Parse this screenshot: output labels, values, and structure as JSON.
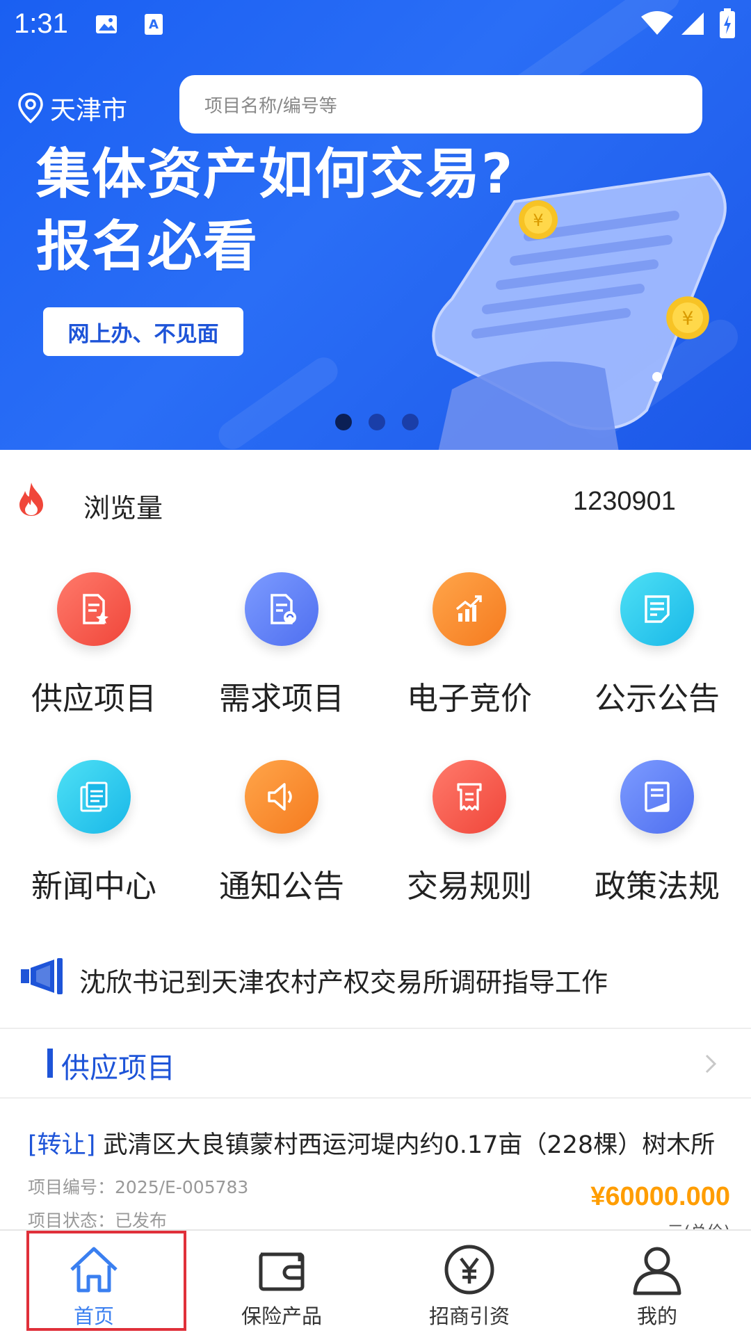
{
  "status_bar": {
    "time": "1:31"
  },
  "header": {
    "location": "天津市",
    "search_placeholder": "项目名称/编号等"
  },
  "banner": {
    "headline_line1": "集体资产如何交易?",
    "headline_line2": "报名必看",
    "badge": "网上办、不见面",
    "carousel": {
      "total": 3,
      "active": 0
    }
  },
  "views": {
    "label": "浏览量",
    "count": "1230901"
  },
  "menu": [
    {
      "label": "供应项目",
      "icon": "supply-doc-icon",
      "color_from": "#ff7a6b",
      "color_to": "#f0463a"
    },
    {
      "label": "需求项目",
      "icon": "demand-doc-icon",
      "color_from": "#7c9bff",
      "color_to": "#4f6ff0"
    },
    {
      "label": "电子竞价",
      "icon": "bid-chart-icon",
      "color_from": "#ffa54a",
      "color_to": "#f57b1f"
    },
    {
      "label": "公示公告",
      "icon": "notice-doc-icon",
      "color_from": "#4ee0f5",
      "color_to": "#19b8e8"
    },
    {
      "label": "新闻中心",
      "icon": "news-icon",
      "color_from": "#4ee0f5",
      "color_to": "#19b8e8"
    },
    {
      "label": "通知公告",
      "icon": "speaker-icon",
      "color_from": "#ffa54a",
      "color_to": "#f57b1f"
    },
    {
      "label": "交易规则",
      "icon": "receipt-icon",
      "color_from": "#ff7a6b",
      "color_to": "#f0463a"
    },
    {
      "label": "政策法规",
      "icon": "policy-book-icon",
      "color_from": "#7c9bff",
      "color_to": "#4f6ff0"
    }
  ],
  "ticker": {
    "text": "沈欣书记到天津农村产权交易所调研指导工作"
  },
  "section": {
    "title": "供应项目"
  },
  "project": {
    "tag": "[转让]",
    "title": "武清区大良镇蒙村西运河堤内约0.17亩（228棵）树木所",
    "number_label": "项目编号：",
    "number": "2025/E-005783",
    "status_label": "项目状态：",
    "status": "已发布",
    "price": "¥60000.000",
    "price_unit": "元(总价)"
  },
  "tabs": [
    {
      "label": "首页",
      "icon": "home-icon",
      "active": true
    },
    {
      "label": "保险产品",
      "icon": "wallet-icon",
      "active": false
    },
    {
      "label": "招商引资",
      "icon": "yuan-icon",
      "active": false
    },
    {
      "label": "我的",
      "icon": "user-icon",
      "active": false
    }
  ],
  "colors": {
    "accent": "#1e54d8",
    "price": "#ff9d00",
    "active_tab": "#3a7ff0",
    "highlight": "#e0303a"
  }
}
